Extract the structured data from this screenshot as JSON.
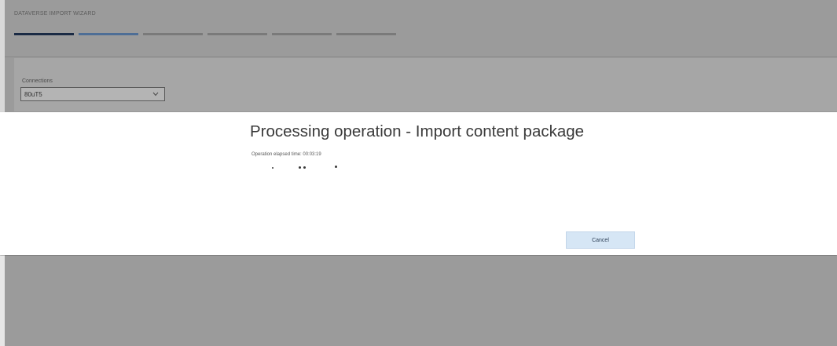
{
  "wizard": {
    "title": "DATAVERSE IMPORT WIZARD",
    "steps": [
      {
        "state": "done"
      },
      {
        "state": "active"
      },
      {
        "state": "pending"
      },
      {
        "state": "pending"
      },
      {
        "state": "pending"
      },
      {
        "state": "pending"
      }
    ]
  },
  "form": {
    "connection_label": "Connections",
    "connection_value": "80uT5"
  },
  "dialog": {
    "title": "Processing operation - Import content package",
    "elapsed_text": "Operation elapsed time: 00:03:19",
    "cancel_label": "Cancel"
  },
  "colors": {
    "step_done": "#1a2a44",
    "step_active": "#4e6e96",
    "step_pending": "#7a7a7a",
    "cancel_bg": "#d6e6f5"
  },
  "icons": {
    "select_chevron": "chevron-down-icon",
    "progress": "progress-dots-icon"
  }
}
